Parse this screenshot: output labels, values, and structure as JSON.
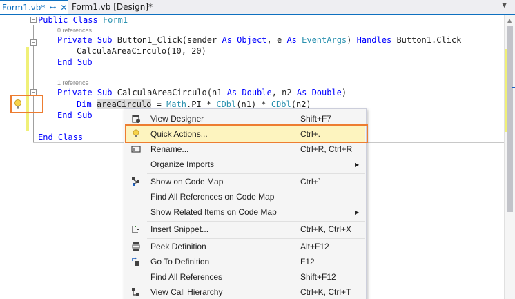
{
  "tabs": [
    {
      "label": "Form1.vb*",
      "pin": "⊷",
      "close": "✕",
      "active": true
    },
    {
      "label": "Form1.vb [Design]*",
      "active": false
    }
  ],
  "tab_dropdown_icon": "chevron-down-icon",
  "code": {
    "class_decl": {
      "kw1": "Public",
      "kw2": "Class",
      "name": "Form1"
    },
    "lens_refs_0": "0 references",
    "sub1": {
      "kw_private": "Private",
      "kw_sub": "Sub",
      "name": "Button1_Click(sender",
      "kw_as1": "As",
      "type1": "Object",
      "e": ", e",
      "kw_as2": "As",
      "type2": "EventArgs",
      "rparen": ")",
      "kw_handles": "Handles",
      "handles_target": "Button1.Click"
    },
    "sub1_body": "CalculaAreaCirculo(10, 20)",
    "end_sub_1": {
      "kw_end": "End",
      "kw_sub": "Sub"
    },
    "lens_refs_1": "1 reference",
    "sub2": {
      "kw_private": "Private",
      "kw_sub": "Sub",
      "name": "CalculaAreaCirculo(n1",
      "kw_as1": "As",
      "type1": "Double",
      "n2": ", n2",
      "kw_as2": "As",
      "type2": "Double",
      "rparen": ")"
    },
    "sub2_body": {
      "kw_dim": "Dim",
      "var": "areaCirculo",
      "eq": " = ",
      "math": "Math",
      "pi": ".PI * ",
      "cdbl1": "CDbl",
      "arg1": "(n1) * ",
      "cdbl2": "CDbl",
      "arg2": "(n2)"
    },
    "end_sub_2": {
      "kw_end": "End",
      "kw_sub": "Sub"
    },
    "end_class": {
      "kw_end": "End",
      "kw_class": "Class"
    },
    "collapse_glyph": "−"
  },
  "context_menu": {
    "items": [
      {
        "label": "View Designer",
        "shortcut": "Shift+F7",
        "icon": "view-designer-icon"
      },
      {
        "label": "Quick Actions...",
        "shortcut": "Ctrl+.",
        "icon": "lightbulb-icon",
        "highlighted": true
      },
      {
        "label": "Rename...",
        "shortcut": "Ctrl+R, Ctrl+R",
        "icon": "rename-icon"
      },
      {
        "label": "Organize Imports",
        "shortcut": "",
        "submenu": true
      },
      {
        "label": "Show on Code Map",
        "shortcut": "Ctrl+`",
        "icon": "code-map-icon"
      },
      {
        "label": "Find All References on Code Map",
        "shortcut": ""
      },
      {
        "label": "Show Related Items on Code Map",
        "shortcut": "",
        "submenu": true
      },
      {
        "label": "Insert Snippet...",
        "shortcut": "Ctrl+K, Ctrl+X",
        "icon": "insert-snippet-icon"
      },
      {
        "label": "Peek Definition",
        "shortcut": "Alt+F12",
        "icon": "peek-definition-icon"
      },
      {
        "label": "Go To Definition",
        "shortcut": "F12",
        "icon": "go-to-definition-icon"
      },
      {
        "label": "Find All References",
        "shortcut": "Shift+F12"
      },
      {
        "label": "View Call Hierarchy",
        "shortcut": "Ctrl+K, Ctrl+T",
        "icon": "call-hierarchy-icon"
      }
    ],
    "submenu_arrow": "▶"
  },
  "colors": {
    "keyword": "#0000ff",
    "type": "#2b91af",
    "accent": "#0e70c0",
    "callout": "#ed7d31",
    "menu_highlight": "#fdf4bf"
  }
}
